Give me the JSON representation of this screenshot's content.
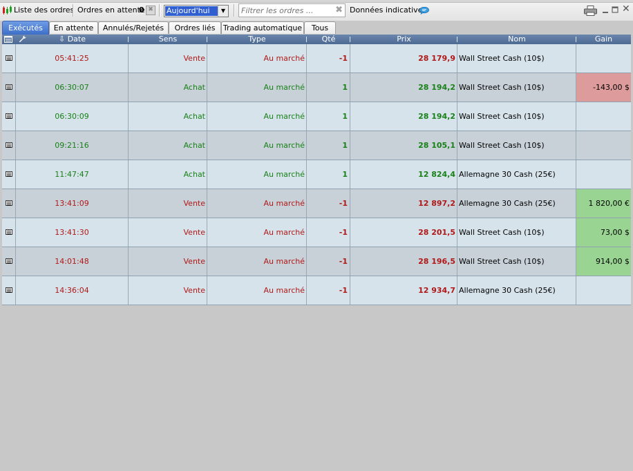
{
  "toolbar": {
    "title": "Liste des ordres",
    "pending_label": "Ordres en attente",
    "pending_count": "0",
    "period_value": "Aujourd'hui",
    "filter_placeholder": "Filtrer les ordres ...",
    "indicative_label": "Données indicatives",
    "icons": [
      "orders-app-icon",
      "clear-icon",
      "dropdown-arrow-icon",
      "clear-filter-icon",
      "info-bubble-icon",
      "print-icon",
      "minimize-icon",
      "maximize-icon",
      "close-icon"
    ]
  },
  "tabs": [
    {
      "label": "Exécutés",
      "active": true
    },
    {
      "label": "En attente",
      "active": false
    },
    {
      "label": "Annulés/Rejetés",
      "active": false
    },
    {
      "label": "Ordres liés",
      "active": false
    },
    {
      "label": "Trading automatique",
      "active": false
    },
    {
      "label": "Tous",
      "active": false
    }
  ],
  "columns": {
    "date": "Date",
    "sens": "Sens",
    "type": "Type",
    "qty": "Qté",
    "price": "Prix",
    "name": "Nom",
    "gain": "Gain"
  },
  "colors": {
    "sell": "#b01818",
    "buy": "#178017",
    "loss_bg": "#dd9b9b",
    "profit_bg": "#99d493",
    "active_tab": "#3d6fc9"
  },
  "rows": [
    {
      "time": "05:41:25",
      "side": "Vente",
      "type": "Au marché",
      "qty": "-1",
      "price": "28 179,9",
      "name": "Wall Street Cash (10$)",
      "gain": "",
      "dir": "sell",
      "gain_state": "none"
    },
    {
      "time": "06:30:07",
      "side": "Achat",
      "type": "Au marché",
      "qty": "1",
      "price": "28 194,2",
      "name": "Wall Street Cash (10$)",
      "gain": "-143,00 $",
      "dir": "buy",
      "gain_state": "loss"
    },
    {
      "time": "06:30:09",
      "side": "Achat",
      "type": "Au marché",
      "qty": "1",
      "price": "28 194,2",
      "name": "Wall Street Cash (10$)",
      "gain": "",
      "dir": "buy",
      "gain_state": "none"
    },
    {
      "time": "09:21:16",
      "side": "Achat",
      "type": "Au marché",
      "qty": "1",
      "price": "28 105,1",
      "name": "Wall Street Cash (10$)",
      "gain": "",
      "dir": "buy",
      "gain_state": "none"
    },
    {
      "time": "11:47:47",
      "side": "Achat",
      "type": "Au marché",
      "qty": "1",
      "price": "12 824,4",
      "name": "Allemagne 30 Cash (25€)",
      "gain": "",
      "dir": "buy",
      "gain_state": "none"
    },
    {
      "time": "13:41:09",
      "side": "Vente",
      "type": "Au marché",
      "qty": "-1",
      "price": "12 897,2",
      "name": "Allemagne 30 Cash (25€)",
      "gain": "1 820,00 €",
      "dir": "sell",
      "gain_state": "profit"
    },
    {
      "time": "13:41:30",
      "side": "Vente",
      "type": "Au marché",
      "qty": "-1",
      "price": "28 201,5",
      "name": "Wall Street Cash (10$)",
      "gain": "73,00 $",
      "dir": "sell",
      "gain_state": "profit"
    },
    {
      "time": "14:01:48",
      "side": "Vente",
      "type": "Au marché",
      "qty": "-1",
      "price": "28 196,5",
      "name": "Wall Street Cash (10$)",
      "gain": "914,00 $",
      "dir": "sell",
      "gain_state": "profit"
    },
    {
      "time": "14:36:04",
      "side": "Vente",
      "type": "Au marché",
      "qty": "-1",
      "price": "12 934,7",
      "name": "Allemagne 30 Cash (25€)",
      "gain": "",
      "dir": "sell",
      "gain_state": "none"
    }
  ]
}
